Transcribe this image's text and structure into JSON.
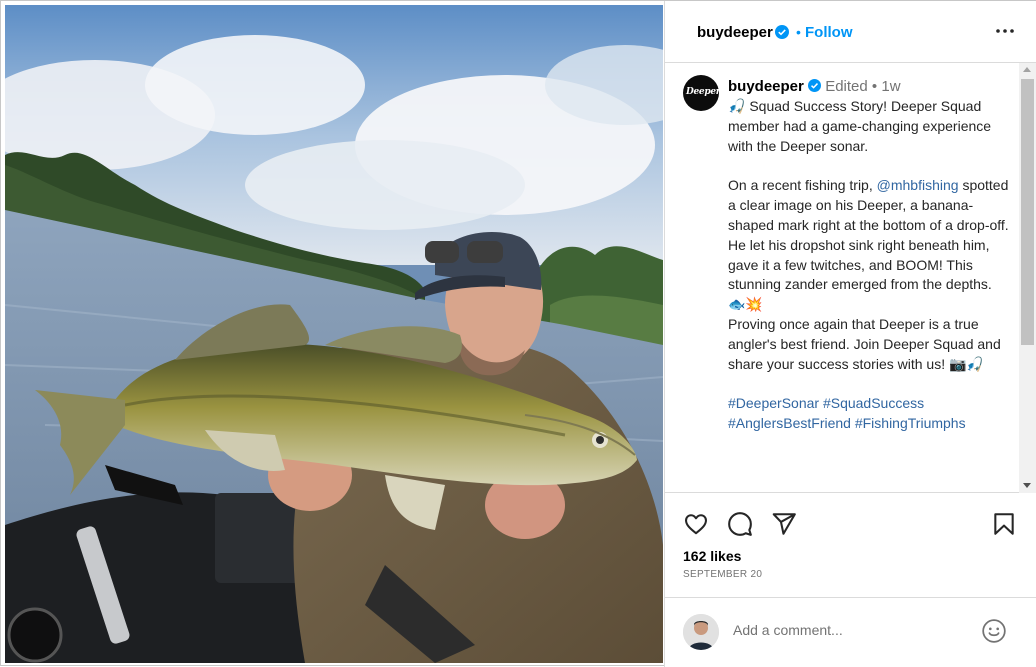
{
  "post": {
    "username": "buydeeper",
    "follow_label": "Follow",
    "dot": "•",
    "avatar_logo_text": "Deeper"
  },
  "caption": {
    "username": "buydeeper",
    "edited": "Edited",
    "meta_dot": "•",
    "time": "1w",
    "para1": "🎣 Squad Success Story! Deeper Squad member had a game-changing experience with the Deeper sonar.",
    "para2_before": "On a recent fishing trip, ",
    "mention": "@mhbfishing",
    "para2_after": " spotted a clear image on his Deeper, a banana-shaped mark right at the bottom of a drop-off. He let his dropshot sink right beneath him, gave it a few twitches, and BOOM! This stunning zander emerged from the depths. 🐟💥",
    "para3": "Proving once again that Deeper is a true angler's best friend. Join Deeper Squad and share your success stories with us! 📷🎣",
    "hashtags": "#DeeperSonar #SquadSuccess #AnglersBestFriend #FishingTriumphs"
  },
  "actions": {
    "likes": "162 likes",
    "date": "SEPTEMBER 20"
  },
  "comment": {
    "placeholder": "Add a comment..."
  },
  "icons": {
    "more": "more-options-icon",
    "verified": "verified-badge-icon",
    "like": "heart-icon",
    "comment": "comment-icon",
    "share": "share-icon",
    "save": "bookmark-icon",
    "emoji": "emoji-icon"
  },
  "colors": {
    "accent": "#0095f6",
    "link": "#3166a1",
    "muted": "#737373",
    "border": "#dbdbdb"
  }
}
